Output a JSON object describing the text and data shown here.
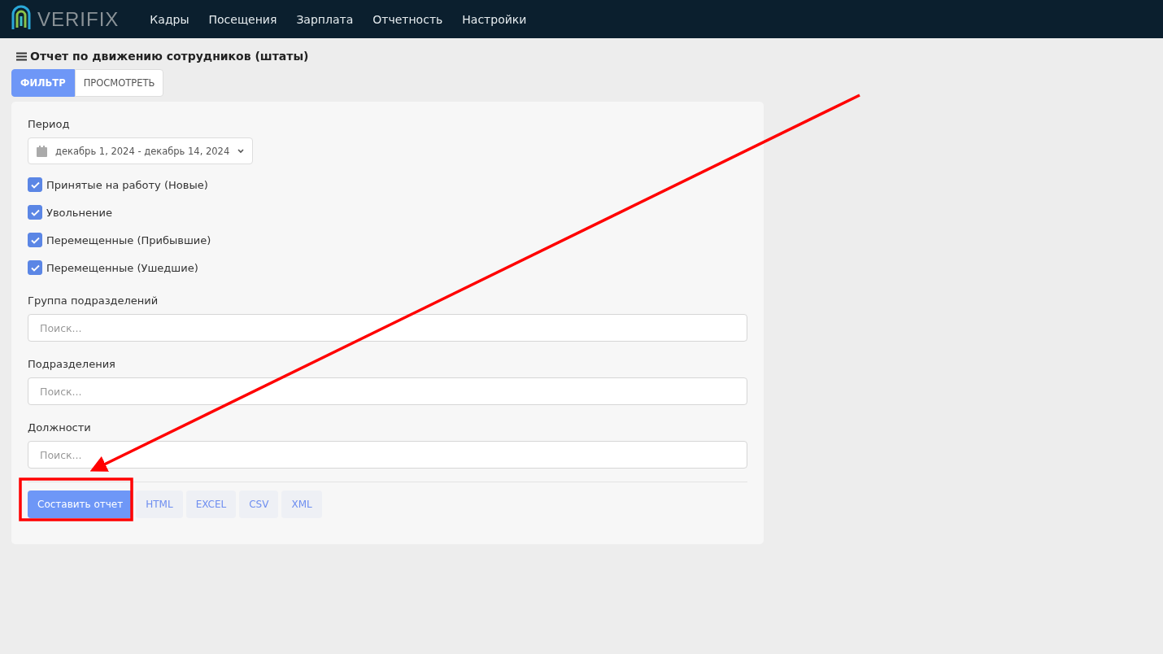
{
  "logo": {
    "text": "VERIFIX"
  },
  "nav": [
    {
      "label": "Кадры"
    },
    {
      "label": "Посещения"
    },
    {
      "label": "Зарплата"
    },
    {
      "label": "Отчетность"
    },
    {
      "label": "Настройки"
    }
  ],
  "page_title": "Отчет по движению сотрудников (штаты)",
  "tabs": [
    {
      "label": "ФИЛЬТР",
      "selected": true
    },
    {
      "label": "ПРОСМОТРЕТЬ",
      "selected": false
    }
  ],
  "period": {
    "label": "Период",
    "value": "декабрь 1, 2024 - декабрь 14, 2024"
  },
  "checkboxes": [
    {
      "label": "Принятые на работу (Новые)",
      "checked": true
    },
    {
      "label": "Увольнение",
      "checked": true
    },
    {
      "label": "Перемещенные (Прибывшие)",
      "checked": true
    },
    {
      "label": "Перемещенные (Ушедшие)",
      "checked": true
    }
  ],
  "fields": [
    {
      "label": "Группа подразделений",
      "placeholder": "Поиск..."
    },
    {
      "label": "Подразделения",
      "placeholder": "Поиск..."
    },
    {
      "label": "Должности",
      "placeholder": "Поиск..."
    }
  ],
  "buttons": [
    {
      "label": "Составить отчет",
      "kind": "primary"
    },
    {
      "label": "HTML",
      "kind": "format"
    },
    {
      "label": "EXCEL",
      "kind": "format"
    },
    {
      "label": "CSV",
      "kind": "format"
    },
    {
      "label": "XML",
      "kind": "format"
    }
  ]
}
